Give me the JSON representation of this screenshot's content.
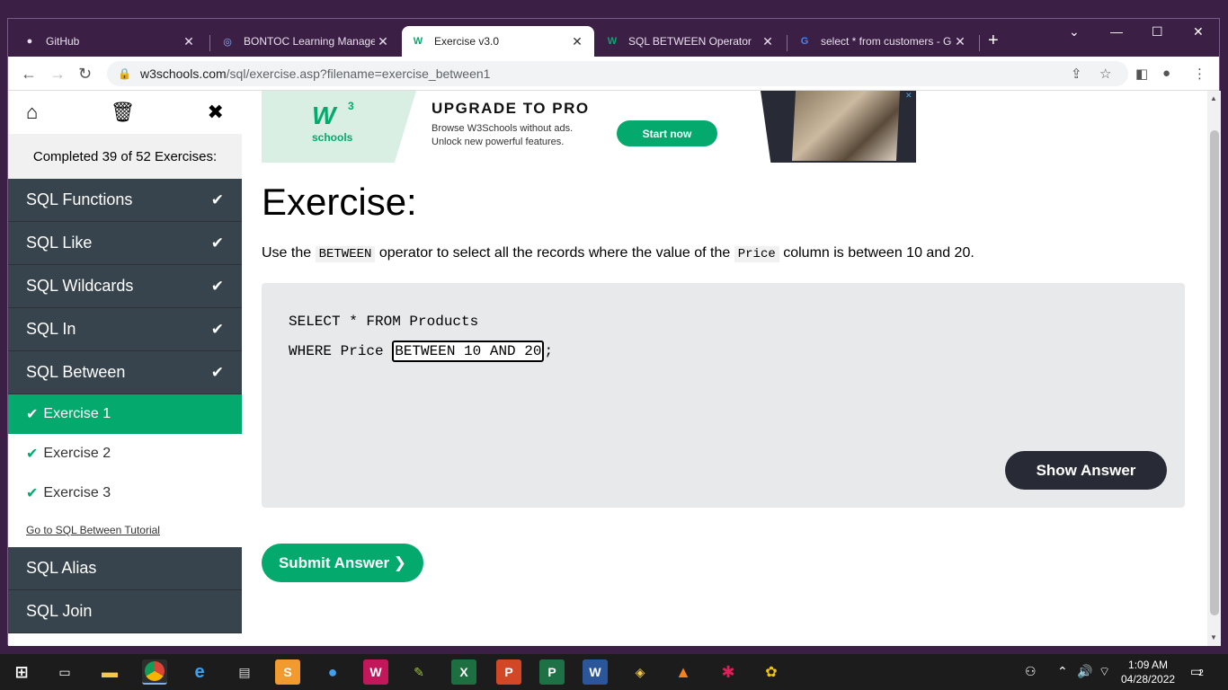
{
  "browser": {
    "tabs": [
      {
        "title": "GitHub",
        "favicon": "github-icon"
      },
      {
        "title": "BONTOC Learning Managem",
        "favicon": "lms-icon"
      },
      {
        "title": "Exercise v3.0",
        "favicon": "w3schools-icon"
      },
      {
        "title": "SQL BETWEEN Operator",
        "favicon": "w3schools-icon"
      },
      {
        "title": "select * from customers - Go",
        "favicon": "google-icon"
      }
    ],
    "active_tab": 2,
    "url_host": "w3schools.com",
    "url_path": "/sql/exercise.asp?filename=exercise_between1"
  },
  "sidebar": {
    "completed_text": "Completed 39 of 52 Exercises:",
    "sections_before": [
      {
        "label": "SQL Functions"
      },
      {
        "label": "SQL Like"
      },
      {
        "label": "SQL Wildcards"
      },
      {
        "label": "SQL In"
      },
      {
        "label": "SQL Between"
      }
    ],
    "exercises": [
      {
        "label": "Exercise 1"
      },
      {
        "label": "Exercise 2"
      },
      {
        "label": "Exercise 3"
      }
    ],
    "tutorial_link": "Go to SQL Between Tutorial",
    "sections_after": [
      {
        "label": "SQL Alias"
      },
      {
        "label": "SQL Join"
      }
    ]
  },
  "ad": {
    "brand": "W",
    "brand_sup": "3",
    "brand_sub": "schools",
    "headline": "UPGRADE TO PRO",
    "line1": "Browse W3Schools without ads.",
    "line2": "Unlock new powerful features.",
    "cta": "Start now"
  },
  "exercise": {
    "title": "Exercise:",
    "desc_pre": "Use the ",
    "desc_code1": "BETWEEN",
    "desc_mid": " operator to select all the records where the value of the ",
    "desc_code2": "Price",
    "desc_post": " column is between 10 and 20.",
    "code_line1": "SELECT * FROM Products",
    "code_line2_pre": "WHERE Price ",
    "code_input_value": "BETWEEN 10 AND 20",
    "code_line2_post": ";",
    "show_answer": "Show Answer",
    "submit": "Submit Answer ❯"
  },
  "taskbar": {
    "time": "1:09 AM",
    "date": "04/28/2022",
    "notifications": "2"
  },
  "colors": {
    "accent_green": "#04aa6d",
    "sidebar_dark": "#38444d",
    "button_dark": "#282a35",
    "browser_frame": "#3b1f45"
  }
}
